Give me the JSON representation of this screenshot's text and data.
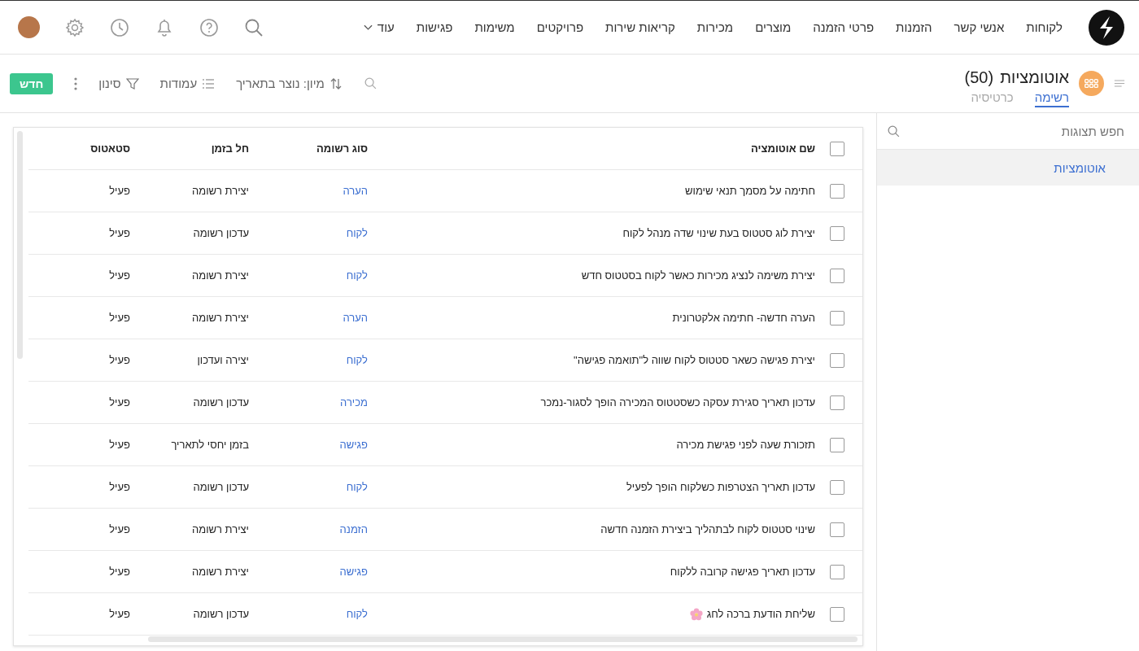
{
  "nav": {
    "items": [
      {
        "label": "לקוחות"
      },
      {
        "label": "אנשי קשר"
      },
      {
        "label": "הזמנות"
      },
      {
        "label": "פרטי הזמנה"
      },
      {
        "label": "מוצרים"
      },
      {
        "label": "מכירות"
      },
      {
        "label": "קריאות שירות"
      },
      {
        "label": "פרויקטים"
      },
      {
        "label": "משימות"
      },
      {
        "label": "פגישות"
      }
    ],
    "more": "עוד"
  },
  "header": {
    "title": "אוטומציות",
    "count": "(50)",
    "tabs": [
      {
        "label": "רשימה",
        "selected": true
      },
      {
        "label": "כרטיסיה",
        "selected": false
      }
    ]
  },
  "toolbar": {
    "sort": "מיון: נוצר בתאריך",
    "columns": "עמודות",
    "filter": "סינון",
    "new_button": "חדש"
  },
  "sidebar": {
    "search": {
      "placeholder": "חפש תצוגות"
    },
    "items": [
      {
        "label": "אוטומציות",
        "selected": true
      }
    ]
  },
  "table": {
    "columns": [
      "שם אוטומציה",
      "סוג רשומה",
      "חל בזמן",
      "סטאטוס"
    ],
    "header_checked": false,
    "rows": [
      {
        "checked": false,
        "name": "חתימה על מסמך תנאי שימוש",
        "type": "הערה",
        "trigger": "יצירת רשומה",
        "status": "פעיל"
      },
      {
        "checked": false,
        "name": "יצירת לוג סטטוס בעת שינוי שדה מנהל לקוח",
        "type": "לקוח",
        "trigger": "עדכון רשומה",
        "status": "פעיל"
      },
      {
        "checked": false,
        "name": "יצירת משימה לנציג מכירות כאשר לקוח בסטטוס חדש",
        "type": "לקוח",
        "trigger": "יצירת רשומה",
        "status": "פעיל"
      },
      {
        "checked": false,
        "name": "הערה חדשה- חתימה אלקטרונית",
        "type": "הערה",
        "trigger": "יצירת רשומה",
        "status": "פעיל"
      },
      {
        "checked": false,
        "name": "יצירת פגישה כשאר סטטוס לקוח שווה ל\"תואמה פגישה\"",
        "type": "לקוח",
        "trigger": "יצירה ועדכון",
        "status": "פעיל"
      },
      {
        "checked": false,
        "name": "עדכון תאריך סגירת עסקה כשסטטוס המכירה הופך לסגור-נמכר",
        "type": "מכירה",
        "trigger": "עדכון רשומה",
        "status": "פעיל"
      },
      {
        "checked": false,
        "name": "תזכורת שעה לפני פגישת מכירה",
        "type": "פגישה",
        "trigger": "בזמן יחסי לתאריך",
        "status": "פעיל"
      },
      {
        "checked": false,
        "name": "עדכון תאריך הצטרפות כשלקוח הופך לפעיל",
        "type": "לקוח",
        "trigger": "עדכון רשומה",
        "status": "פעיל"
      },
      {
        "checked": false,
        "name": "שינוי סטטוס לקוח לבתהליך ביצירת הזמנה חדשה",
        "type": "הזמנה",
        "trigger": "יצירת רשומה",
        "status": "פעיל"
      },
      {
        "checked": false,
        "name": "עדכון תאריך פגישה קרובה ללקוח",
        "type": "פגישה",
        "trigger": "יצירת רשומה",
        "status": "פעיל"
      },
      {
        "checked": false,
        "name": "שליחת הודעת ברכה לחג",
        "kind": "flower",
        "type": "לקוח",
        "trigger": "עדכון רשומה",
        "status": "פעיל"
      }
    ]
  }
}
